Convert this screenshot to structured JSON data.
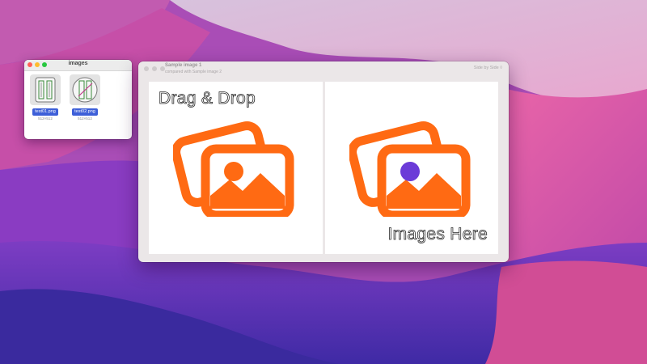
{
  "finder": {
    "title": "images",
    "files": [
      {
        "name": "test01.png",
        "size": "512×512",
        "icon": "image-thumbnail-icon"
      },
      {
        "name": "test02.png",
        "size": "512×512",
        "icon": "image-thumbnail-icon"
      }
    ]
  },
  "app": {
    "title": "Sample image 1",
    "subtitle": "compared with Sample image 2",
    "mode": "Side by Side ◊",
    "panes": {
      "left_text": "Drag & Drop",
      "right_text": "Images Here",
      "left_icon": "photos-icon",
      "right_icon": "photos-icon"
    }
  },
  "colors": {
    "accent": "#ff6a13",
    "left_sun": "#ff6a13",
    "right_sun": "#6b3bd8",
    "selection": "#3d5fd8"
  }
}
